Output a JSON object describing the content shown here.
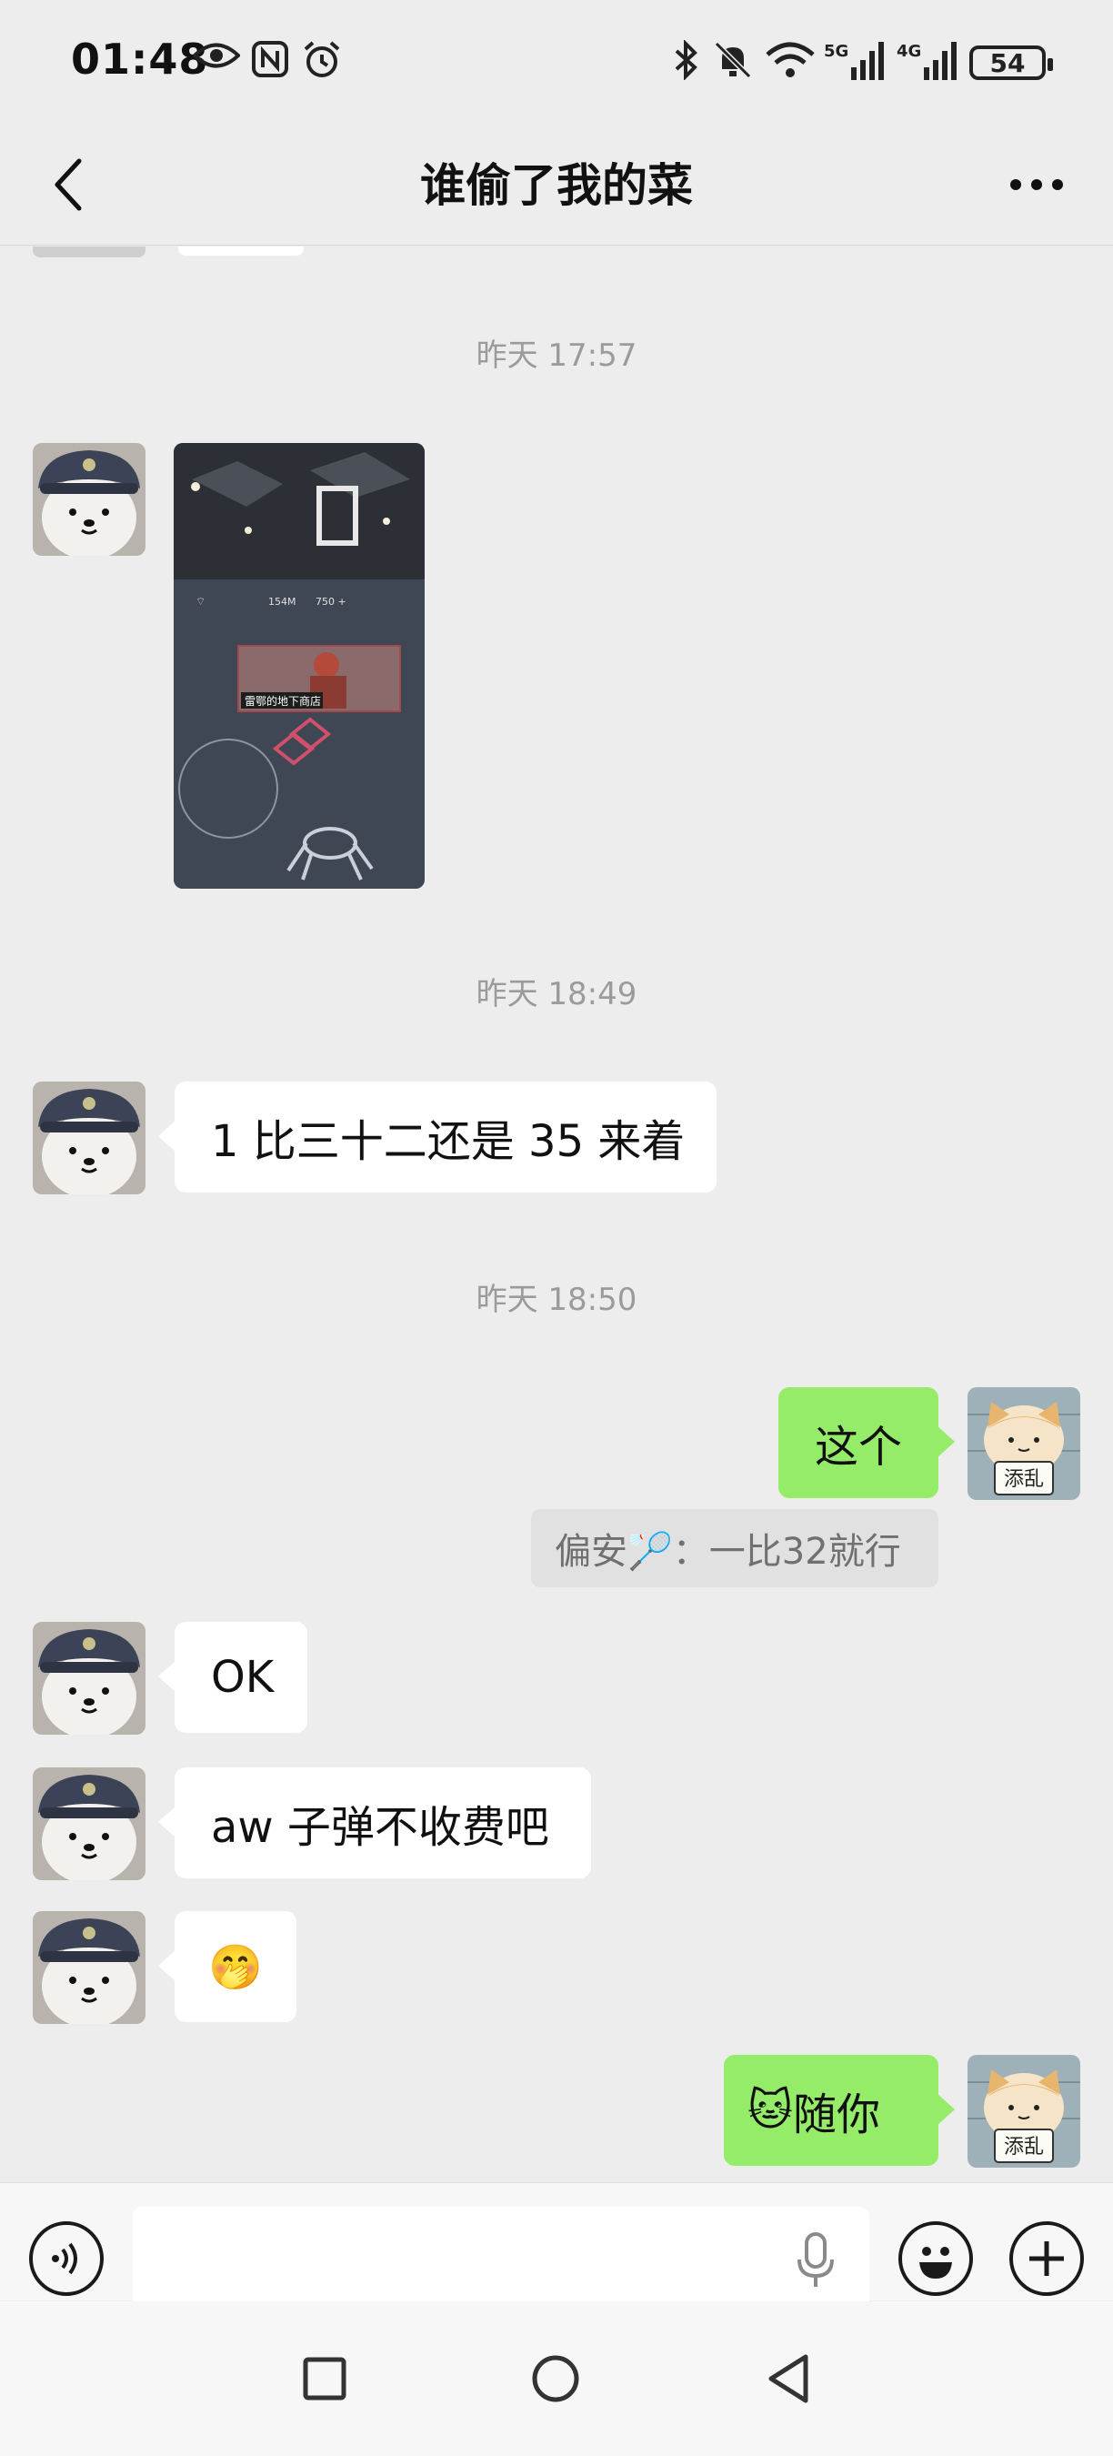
{
  "status_bar": {
    "time": "01:48",
    "battery": "54",
    "icons": [
      "eye-icon",
      "nfc-icon",
      "alarm-icon",
      "bluetooth-icon",
      "mute-icon",
      "wifi-icon",
      "signal-5g-icon",
      "signal-4g-icon"
    ]
  },
  "header": {
    "title": "谁偷了我的菜",
    "back_icon": "chevron-left-icon",
    "more_icon": "more-dots-icon"
  },
  "messages": {
    "ts1": "昨天 17:57",
    "ts2": "昨天 18:49",
    "ts3": "昨天 18:50",
    "m2_text": "1 比三十二还是 35 来着",
    "m3_text": "这个",
    "quote_text": "偏安🏸：一比32就行",
    "m4_text": "OK",
    "m5_text": "aw 子弹不收费吧",
    "m6_emoji": "🤭",
    "m7_emoji": "🐱",
    "m7_text": "随你"
  },
  "photo": {
    "banner_text": "雷鄂的地下商店",
    "stat_1": "154M",
    "stat_2": "750 +"
  },
  "avatars": {
    "other_icon": "bear-avatar-icon",
    "self_icon": "cat-avatar-icon",
    "self_sign": "添乱"
  },
  "input_bar": {
    "placeholder": "",
    "voice_icon": "voice-icon",
    "mic_icon": "mic-icon",
    "emoji_icon": "emoji-icon",
    "plus_icon": "plus-icon"
  },
  "colors": {
    "background": "#ededed",
    "incoming_bubble": "#ffffff",
    "outgoing_bubble": "#95ec69",
    "timestamp": "#9b9b9b"
  }
}
